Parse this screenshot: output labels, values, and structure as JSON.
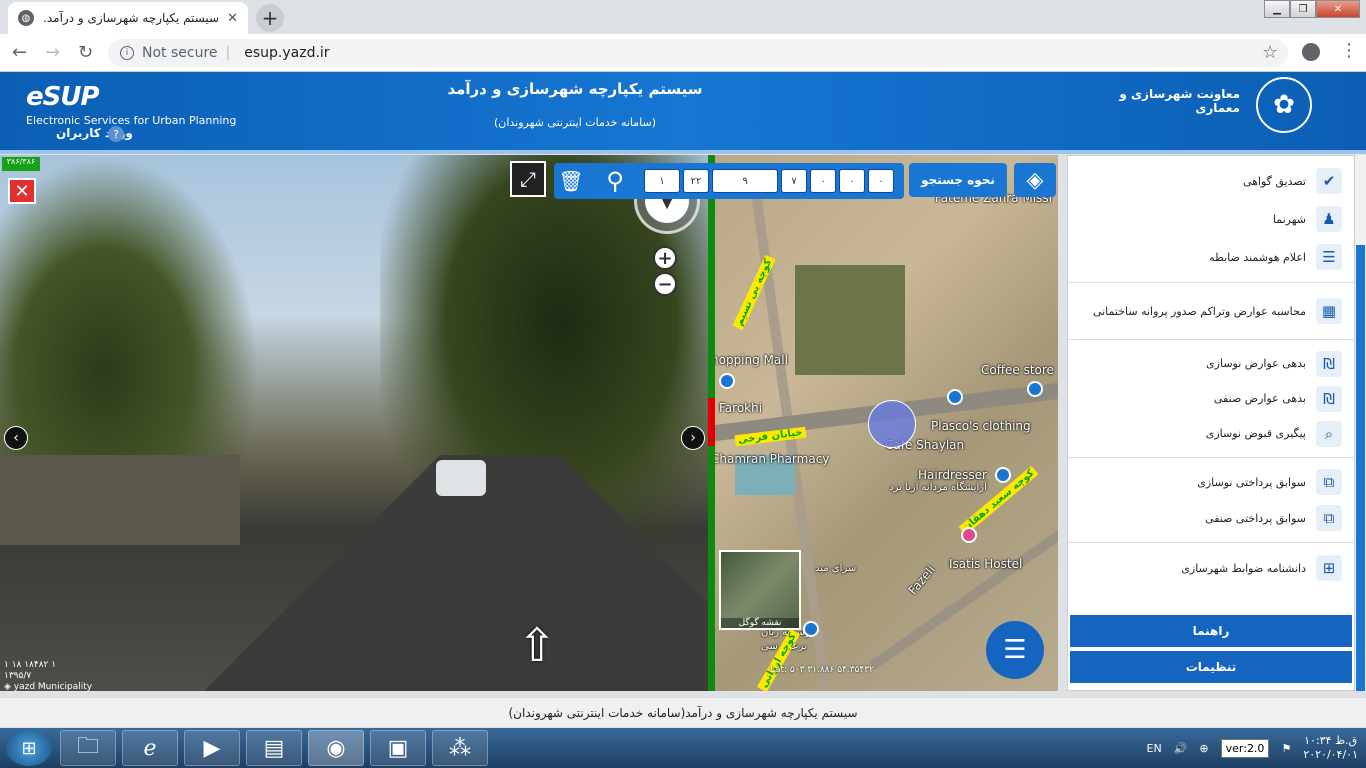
{
  "browser": {
    "tab_title": "سیستم یکپارچه شهرسازی و درآمد...",
    "tab_favicon": "globe-icon",
    "security": "Not secure",
    "url": "esup.yazd.ir"
  },
  "header": {
    "logo": "eSUP",
    "logo_sub": "Electronic Services for Urban Planning",
    "login": "ورود کاربران",
    "help": "?",
    "title": "سیستم یکپارچه شهرسازی و درآمد",
    "subtitle": "(سامانه خدمات اینترنتی شهروندان)",
    "department": "معاونت شهرسازی و معماری"
  },
  "streetview": {
    "badge": "۳۸۶/۳۸۶",
    "close": "✕",
    "caption_line1": "۱ ۱۸ ۱۸۴۸۲ ۱",
    "caption_line2": "۱۳۹۵/۷",
    "caption_line3": "◈ yazd Municipality"
  },
  "toolbar": {
    "cells": [
      "۰",
      "۰",
      "۰",
      "۷",
      "۹",
      "۲۲",
      "۱"
    ],
    "how_to_search": "نحوه جستجو"
  },
  "map": {
    "labels": [
      "Fateme Zahra Missi",
      "hopping Mall",
      "Coffee store",
      "Farokhi",
      "Plasco's clothing",
      "Cafe Shaylan",
      "Chamran Pharmacy",
      "Hairdresser",
      "آرایشگاه مردانه آریا یزد",
      "Isatis Hostel",
      "Fazeli",
      "سرای مید",
      "موسسه زبان",
      "برعلی سی"
    ],
    "road_labels": [
      "کوچه بی نسیم",
      "خیابان فرخی",
      "کوچه سعید دهقان",
      "کوچه ارزانی"
    ],
    "minimap_label": "نقشه گوگل",
    "coords": "Lat: ۵۰۳ ۳۱.۸۸۶ ۵۴.۳۵۴۳۲"
  },
  "panel": {
    "groups": [
      [
        {
          "label": "تصدیق گواهی",
          "icon": "document-check-icon"
        },
        {
          "label": "شهرنما",
          "icon": "person-pin-icon"
        },
        {
          "label": "اعلام هوشمند ضابطه",
          "icon": "document-lines-icon"
        }
      ],
      [
        {
          "label": "محاسبه عوارض وتراکم صدور پروانه ساختمانی",
          "icon": "calculator-icon"
        }
      ],
      [
        {
          "label": "بدهی عوارض نوسازی",
          "icon": "money-icon"
        },
        {
          "label": "بدهی عوارض صنفی",
          "icon": "money-icon"
        },
        {
          "label": "پیگیری قبوض نوسازی",
          "icon": "receipt-search-icon"
        }
      ],
      [
        {
          "label": "سوابق پرداختی نوسازی",
          "icon": "payment-history-icon"
        },
        {
          "label": "سوابق پرداختی صنفی",
          "icon": "payment-history-icon"
        }
      ],
      [
        {
          "label": "دانشنامه ضوابط شهرسازی",
          "icon": "sitemap-icon"
        }
      ]
    ],
    "guide_button": "راهنما",
    "settings_button": "تنظیمات"
  },
  "footer": "سیستم یکپارچه شهرسازی و درآمد(سامانه خدمات اینترنتی شهروندان)",
  "taskbar": {
    "lang": "EN",
    "version": "ver:2.0",
    "time": "ق.ظ ۱۰:۳۴",
    "date": "۲۰۲۰/۰۴/۰۱"
  }
}
